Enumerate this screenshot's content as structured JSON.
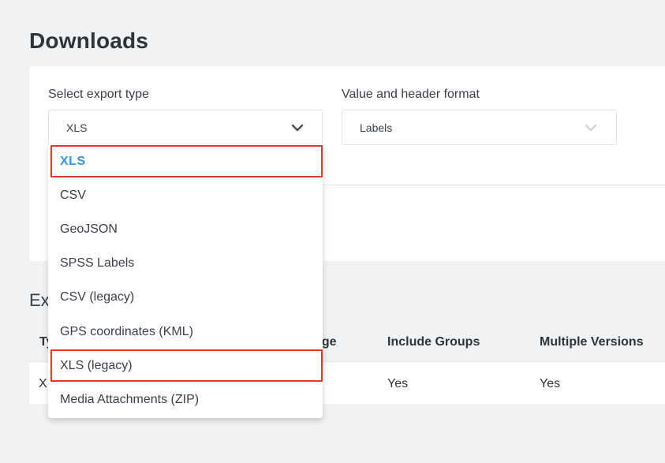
{
  "page": {
    "title": "Downloads"
  },
  "settings": {
    "export_type_label": "Select export type",
    "export_type_value": "XLS",
    "format_label": "Value and header format",
    "format_value": "Labels"
  },
  "dropdown": {
    "options": [
      "XLS",
      "CSV",
      "GeoJSON",
      "SPSS Labels",
      "CSV (legacy)",
      "GPS coordinates (KML)",
      "XLS (legacy)",
      "Media Attachments (ZIP)"
    ],
    "selected": "XLS"
  },
  "exports": {
    "title_partial": "Ex",
    "headers": {
      "type_partial": "Ty",
      "language_partial": "age",
      "include_groups": "Include Groups",
      "multiple_versions": "Multiple Versions"
    },
    "rows": [
      {
        "type_partial": "X",
        "include_groups": "Yes",
        "multiple_versions": "Yes"
      }
    ]
  },
  "colors": {
    "accent": "#2f96e8",
    "highlight": "#e8391f",
    "background": "#f1f2f4"
  },
  "icons": {
    "chevron": "chevron-down-icon"
  }
}
